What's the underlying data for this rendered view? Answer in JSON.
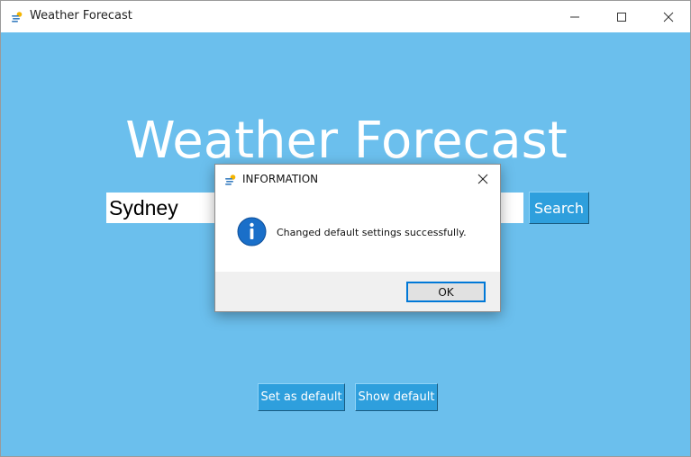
{
  "window": {
    "title": "Weather Forecast",
    "app_icon": "weather-cloud-sun-icon",
    "controls": {
      "minimize_icon": "minimize-icon",
      "maximize_icon": "maximize-icon",
      "close_icon": "close-icon"
    }
  },
  "main": {
    "heading": "Weather Forecast",
    "city_input_value": "Sydney",
    "search_label": "Search",
    "set_default_label": "Set as default",
    "show_default_label": "Show default"
  },
  "dialog": {
    "title": "INFORMATION",
    "icon": "info-icon",
    "message": "Changed default settings successfully.",
    "ok_label": "OK"
  },
  "colors": {
    "background": "#6bbfed",
    "button": "#2e9fdd",
    "dialog_accent": "#0078d7",
    "info_icon": "#1a6fc9"
  }
}
